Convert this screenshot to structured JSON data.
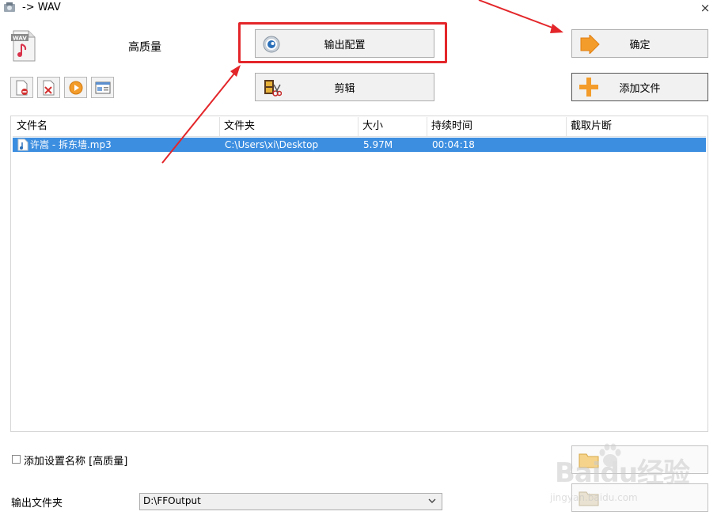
{
  "window": {
    "title": "-> WAV",
    "close_glyph": "×",
    "app_icon": "app-icon"
  },
  "preset": {
    "label": "高质量",
    "icon": "wav-file-icon"
  },
  "buttons": {
    "output_config": "输出配置",
    "clip": "剪辑",
    "ok": "确定",
    "add_file": "添加文件"
  },
  "toolbar": [
    {
      "icon": "remove-file-icon"
    },
    {
      "icon": "clear-list-icon"
    },
    {
      "icon": "play-icon"
    },
    {
      "icon": "media-info-icon"
    }
  ],
  "file_list": {
    "columns": [
      "文件名",
      "文件夹",
      "大小",
      "持续时间",
      "截取片断"
    ],
    "rows": [
      {
        "name": "许嵩 - 拆东墙.mp3",
        "folder": "C:\\Users\\xi\\Desktop",
        "size": "5.97M",
        "duration": "00:04:18",
        "clip": "",
        "selected": true
      }
    ]
  },
  "bottom": {
    "add_name_label": "添加设置名称 [高质量]",
    "add_name_checked": false,
    "output_folder_label": "输出文件夹",
    "output_folder_value": "D:\\FFOutput"
  },
  "watermark": {
    "line1": "Baidu经验",
    "line2": "jingyan.baidu.com"
  },
  "colors": {
    "highlight_red": "#e3262a",
    "selection_blue": "#3c8ee0",
    "accent_orange": "#f39c2b"
  }
}
